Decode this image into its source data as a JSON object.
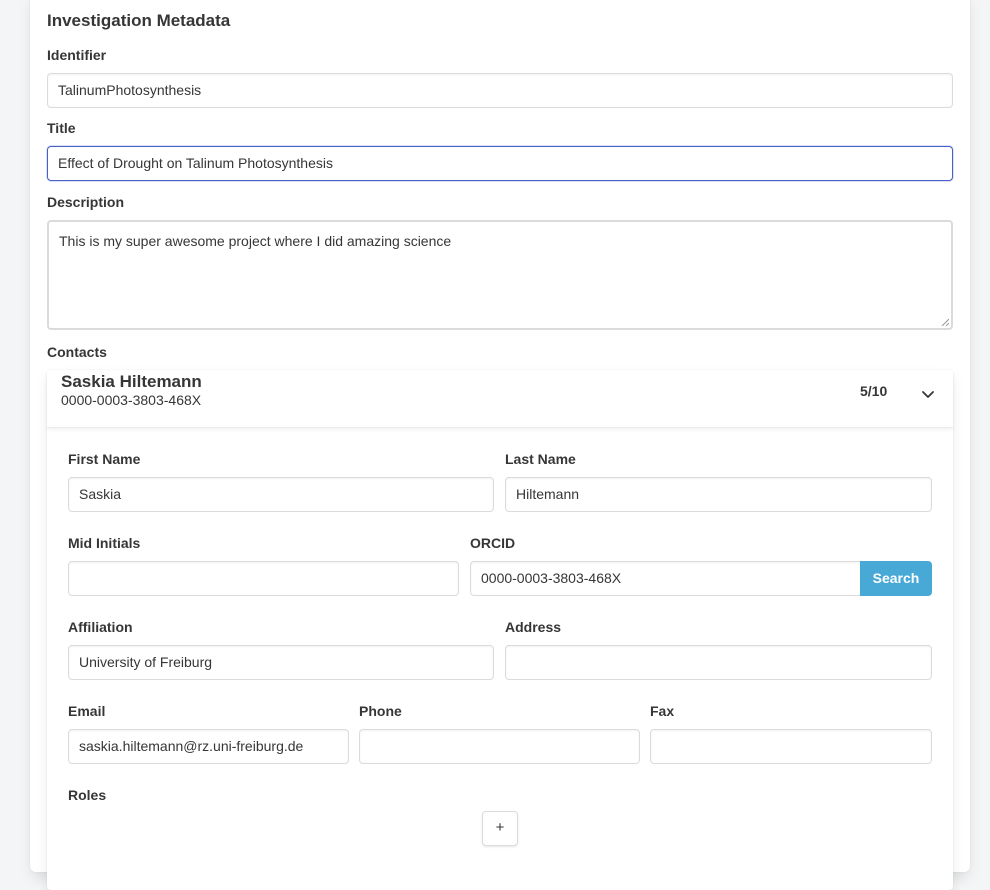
{
  "section_title": "Investigation Metadata",
  "identifier": {
    "label": "Identifier",
    "value": "TalinumPhotosynthesis"
  },
  "title": {
    "label": "Title",
    "value": "Effect of Drought on Talinum Photosynthesis"
  },
  "description": {
    "label": "Description",
    "value": "This is my super awesome project where I did amazing science"
  },
  "contacts": {
    "label": "Contacts",
    "card": {
      "name": "Saskia Hiltemann",
      "orcid": "0000-0003-3803-468X",
      "count": "5/10",
      "toggle_icon": "chevron-down-icon"
    },
    "fields": {
      "first_name": {
        "label": "First Name",
        "value": "Saskia"
      },
      "last_name": {
        "label": "Last Name",
        "value": "Hiltemann"
      },
      "mid_initials": {
        "label": "Mid Initials",
        "value": ""
      },
      "orcid": {
        "label": "ORCID",
        "value": "0000-0003-3803-468X",
        "button": "Search"
      },
      "affiliation": {
        "label": "Affiliation",
        "value": "University of Freiburg"
      },
      "address": {
        "label": "Address",
        "value": ""
      },
      "email": {
        "label": "Email",
        "value": "saskia.hiltemann@rz.uni-freiburg.de"
      },
      "phone": {
        "label": "Phone",
        "value": ""
      },
      "fax": {
        "label": "Fax",
        "value": ""
      },
      "roles": {
        "label": "Roles",
        "add_button": "+"
      }
    }
  },
  "colors": {
    "focus_border": "#485fc7",
    "info_button": "#48a9d6"
  }
}
